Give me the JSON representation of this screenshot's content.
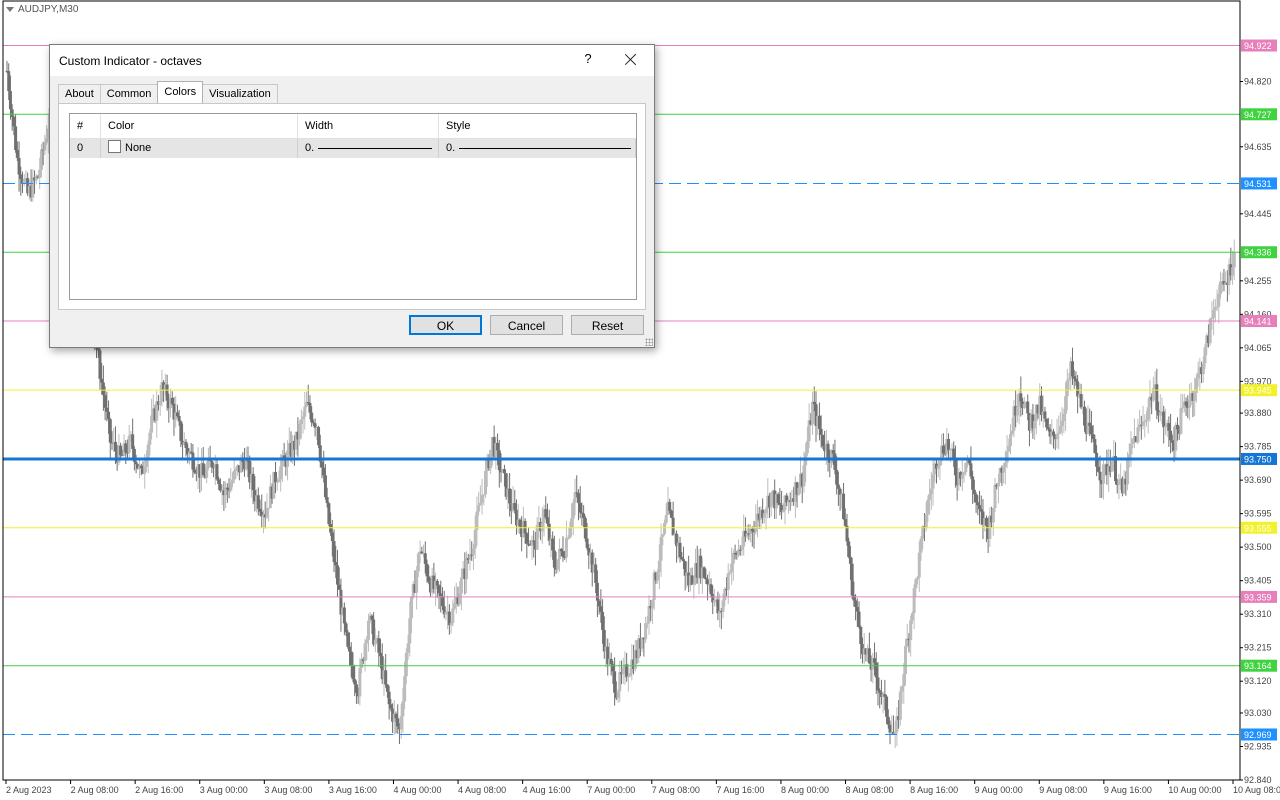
{
  "chart": {
    "symbol": "AUDJPY,M30",
    "colors": {
      "background": "#ffffff",
      "candle_dark": "#707070",
      "candle_light": "#bcbcbc",
      "pink": "#e77fba",
      "green": "#3fd33f",
      "blue": "#1e90ff",
      "yellow": "#f2f22a",
      "main_blue": "#1477d4"
    },
    "price_range": [
      92.84,
      95.0
    ],
    "price_ticks": [
      "94.820",
      "94.635",
      "94.445",
      "94.255",
      "94.160",
      "94.065",
      "93.970",
      "93.880",
      "93.785",
      "93.690",
      "93.595",
      "93.500",
      "93.405",
      "93.310",
      "93.215",
      "93.120",
      "93.030",
      "92.935",
      "92.840"
    ],
    "time_ticks": [
      "2 Aug 2023",
      "2 Aug 08:00",
      "2 Aug 16:00",
      "3 Aug 00:00",
      "3 Aug 08:00",
      "3 Aug 16:00",
      "4 Aug 00:00",
      "4 Aug 08:00",
      "4 Aug 16:00",
      "7 Aug 00:00",
      "7 Aug 08:00",
      "7 Aug 16:00",
      "8 Aug 00:00",
      "8 Aug 08:00",
      "8 Aug 16:00",
      "9 Aug 00:00",
      "9 Aug 08:00",
      "9 Aug 16:00",
      "10 Aug 00:00",
      "10 Aug 08:00"
    ],
    "levels": [
      {
        "price": 94.922,
        "label": "94.922",
        "color": "#e77fba",
        "label_bg": "#e77fba",
        "style": "solid",
        "width": 1
      },
      {
        "price": 94.727,
        "label": "94.727",
        "color": "#3fd33f",
        "label_bg": "#3fd33f",
        "style": "solid",
        "width": 1
      },
      {
        "price": 94.531,
        "label": "94.531",
        "color": "#1e90ff",
        "label_bg": "#1e90ff",
        "style": "dash",
        "width": 1
      },
      {
        "price": 94.336,
        "label": "94.336",
        "color": "#3fd33f",
        "label_bg": "#3fd33f",
        "style": "solid",
        "width": 1
      },
      {
        "price": 94.141,
        "label": "94.141",
        "color": "#e77fba",
        "label_bg": "#e77fba",
        "style": "solid",
        "width": 1
      },
      {
        "price": 93.945,
        "label": "93.945",
        "color": "#f2f22a",
        "label_bg": "#f2f22a",
        "style": "solid",
        "width": 1
      },
      {
        "price": 93.75,
        "label": "93.750",
        "color": "#1477d4",
        "label_bg": "#1477d4",
        "style": "solid",
        "width": 3
      },
      {
        "price": 93.555,
        "label": "93.555",
        "color": "#f2f22a",
        "label_bg": "#f2f22a",
        "style": "solid",
        "width": 1
      },
      {
        "price": 93.359,
        "label": "93.359",
        "color": "#e77fba",
        "label_bg": "#e77fba",
        "style": "solid",
        "width": 1
      },
      {
        "price": 93.164,
        "label": "93.164",
        "color": "#3fd33f",
        "label_bg": "#3fd33f",
        "style": "solid",
        "width": 1
      },
      {
        "price": 92.969,
        "label": "92.969",
        "color": "#1e90ff",
        "label_bg": "#1e90ff",
        "style": "dash",
        "width": 1
      }
    ],
    "price_path": [
      94.85,
      94.6,
      94.5,
      94.55,
      94.7,
      94.8,
      94.6,
      94.4,
      94.2,
      94.0,
      93.8,
      93.75,
      93.8,
      93.7,
      93.85,
      93.95,
      93.9,
      93.8,
      93.75,
      93.7,
      93.75,
      93.65,
      93.7,
      93.75,
      93.65,
      93.6,
      93.7,
      93.75,
      93.8,
      93.9,
      93.85,
      93.6,
      93.4,
      93.2,
      93.1,
      93.3,
      93.2,
      93.05,
      92.98,
      93.3,
      93.5,
      93.4,
      93.35,
      93.3,
      93.4,
      93.5,
      93.65,
      93.8,
      93.7,
      93.6,
      93.55,
      93.5,
      93.6,
      93.45,
      93.5,
      93.65,
      93.55,
      93.4,
      93.2,
      93.1,
      93.15,
      93.2,
      93.3,
      93.45,
      93.6,
      93.5,
      93.4,
      93.45,
      93.4,
      93.3,
      93.45,
      93.5,
      93.55,
      93.6,
      93.65,
      93.6,
      93.65,
      93.7,
      93.9,
      93.8,
      93.75,
      93.6,
      93.35,
      93.2,
      93.15,
      93.05,
      92.95,
      93.2,
      93.4,
      93.6,
      93.75,
      93.8,
      93.7,
      93.75,
      93.6,
      93.55,
      93.7,
      93.8,
      93.95,
      93.85,
      93.9,
      93.8,
      93.85,
      94.0,
      93.9,
      93.8,
      93.7,
      93.75,
      93.65,
      93.8,
      93.85,
      93.95,
      93.85,
      93.8,
      93.9,
      93.95,
      94.05,
      94.2,
      94.25,
      94.35
    ]
  },
  "dialog": {
    "title": "Custom Indicator - octaves",
    "help_label": "?",
    "tabs": [
      {
        "label": "About"
      },
      {
        "label": "Common"
      },
      {
        "label": "Colors"
      },
      {
        "label": "Visualization"
      }
    ],
    "table": {
      "headers": [
        "#",
        "Color",
        "Width",
        "Style"
      ],
      "rows": [
        {
          "index": "0",
          "color": "None",
          "width": "0.",
          "style": "0."
        }
      ]
    },
    "buttons": {
      "ok": "OK",
      "cancel": "Cancel",
      "reset": "Reset"
    }
  }
}
